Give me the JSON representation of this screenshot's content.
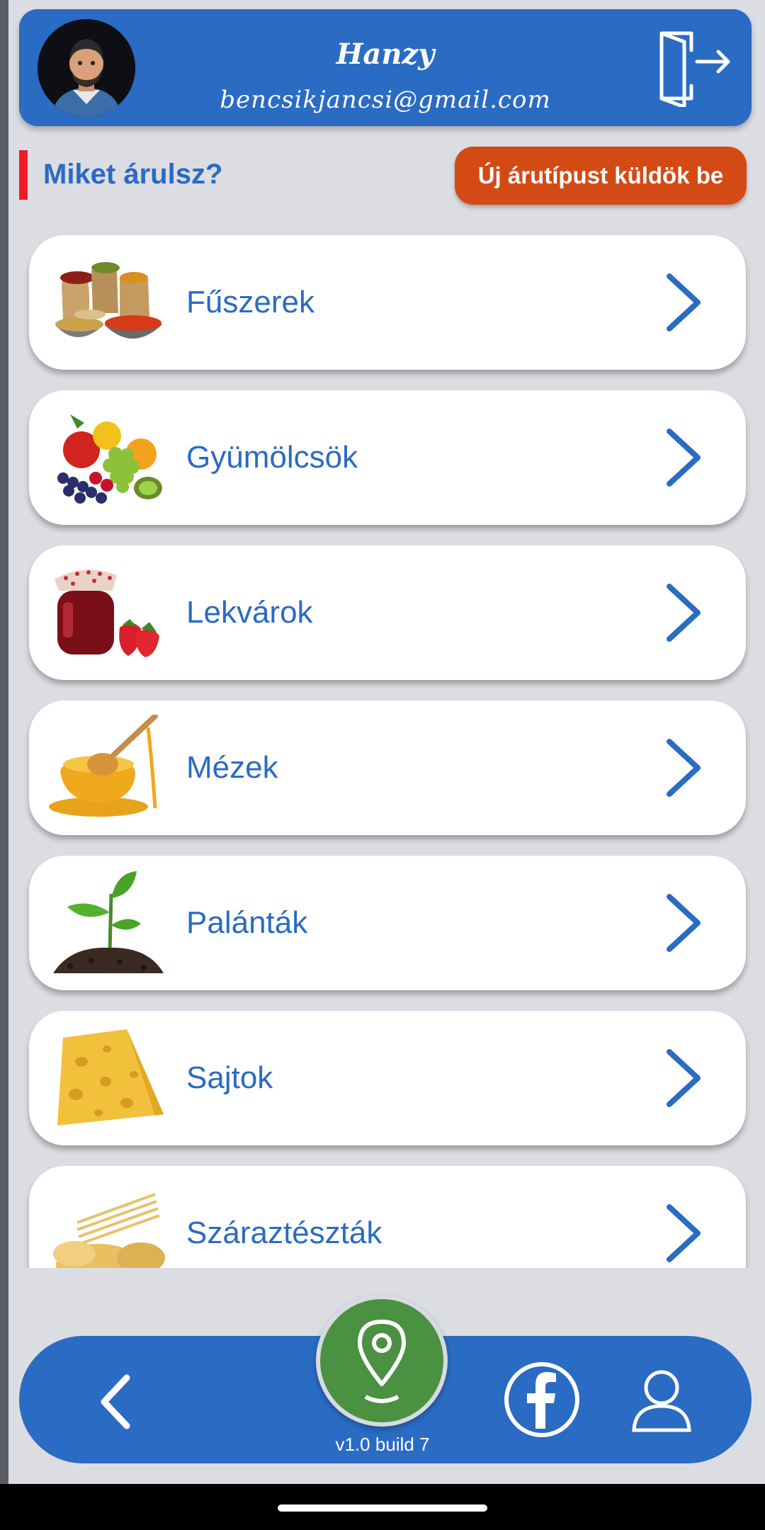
{
  "header": {
    "name": "Hanzy",
    "email": "bencsikjancsi@gmail.com"
  },
  "section": {
    "title": "Miket árulsz?",
    "submit_button": "Új árutípust küldök be"
  },
  "categories": [
    {
      "label": "Fűszerek",
      "icon": "spices-image"
    },
    {
      "label": "Gyümölcsök",
      "icon": "fruits-image"
    },
    {
      "label": "Lekvárok",
      "icon": "jam-image"
    },
    {
      "label": "Mézek",
      "icon": "honey-image"
    },
    {
      "label": "Palánták",
      "icon": "seedling-image"
    },
    {
      "label": "Sajtok",
      "icon": "cheese-image"
    },
    {
      "label": "Száraztészták",
      "icon": "pasta-image"
    }
  ],
  "bottom_nav": {
    "version": "v1.0 build 7"
  },
  "colors": {
    "primary": "#2a6bc3",
    "accent": "#d44a14",
    "map_button": "#4a9141",
    "marker": "#ee1c25"
  }
}
